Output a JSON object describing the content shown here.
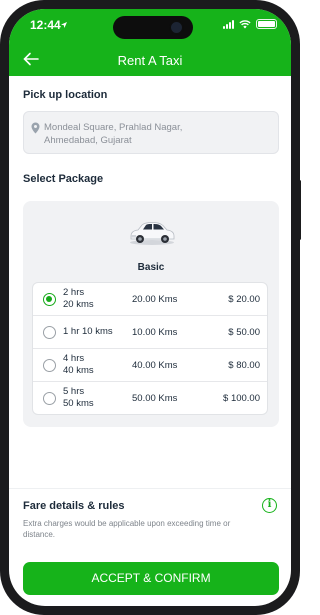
{
  "status_bar": {
    "time": "12:44"
  },
  "header": {
    "title": "Rent A Taxi"
  },
  "pickup": {
    "label": "Pick up location",
    "address_line1": "Mondeal Square, Prahlad Nagar,",
    "address_line2": "Ahmedabad, Gujarat"
  },
  "package": {
    "label": "Select Package",
    "name": "Basic",
    "options": [
      {
        "dur1": "2 hrs",
        "dur2": "20 kms",
        "kms": "20.00 Kms",
        "price": "$ 20.00",
        "selected": true
      },
      {
        "dur1": "1 hr 10 kms",
        "dur2": "",
        "kms": "10.00 Kms",
        "price": "$ 50.00",
        "selected": false
      },
      {
        "dur1": "4 hrs",
        "dur2": "40 kms",
        "kms": "40.00 Kms",
        "price": "$ 80.00",
        "selected": false
      },
      {
        "dur1": "5 hrs",
        "dur2": "50 kms",
        "kms": "50.00 Kms",
        "price": "$ 100.00",
        "selected": false
      }
    ]
  },
  "fare": {
    "title": "Fare details & rules",
    "note": "Extra charges would be applicable upon exceeding time or distance."
  },
  "accept_button": "ACCEPT & CONFIRM",
  "colors": {
    "brand": "#16b31a",
    "text": "#1d2b3a",
    "muted": "#8b9098"
  }
}
